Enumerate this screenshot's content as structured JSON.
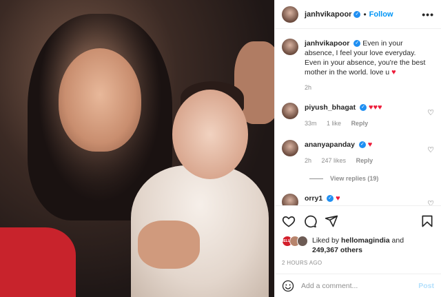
{
  "post": {
    "photo_alt": "Vintage photo",
    "author": {
      "username": "janhvikapoor",
      "verified": true
    },
    "follow_label": "Follow",
    "more_label": "•••",
    "caption": {
      "username": "janhvikapoor",
      "text": "Even in your absence, I feel your love everyday. Even in your absence, you're the best mother in the world. love u",
      "emoji": "♥",
      "time": "2h"
    },
    "comments": [
      {
        "username": "piyush_bhagat",
        "verified": true,
        "text": "♥♥♥",
        "time": "33m",
        "likes": "1 like",
        "reply": "Reply"
      },
      {
        "username": "ananyapanday",
        "verified": true,
        "text": "♥",
        "time": "2h",
        "likes": "247 likes",
        "reply": "Reply",
        "view_replies": "View replies (19)"
      },
      {
        "username": "orry1",
        "verified": true,
        "text": "♥",
        "time": "",
        "likes": "",
        "reply": ""
      }
    ],
    "likes_summary": {
      "prefix": "Liked by",
      "liked_by": "hellomagindia",
      "and": "and",
      "others": "249,367 others",
      "avatar_badge": "HELLO!"
    },
    "post_date": "2 HOURS AGO",
    "comment_input": {
      "placeholder": "Add a comment...",
      "post_label": "Post"
    },
    "icons": [
      "heart-icon",
      "comment-icon",
      "share-icon",
      "bookmark-icon",
      "emoji-icon",
      "verified-icon"
    ],
    "colors": {
      "accent": "#0095f6",
      "heart": "#ed1c3a",
      "verified": "#1f8ff2",
      "muted": "#8e8e8e"
    }
  }
}
